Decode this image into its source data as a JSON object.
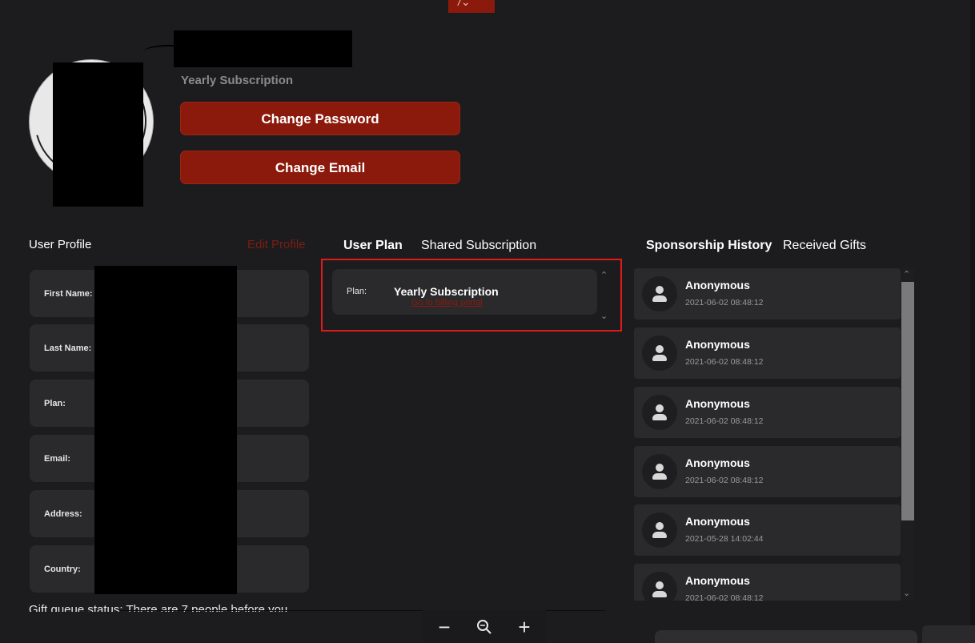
{
  "header": {
    "subscription_label": "Yearly Subscription",
    "change_password": "Change Password",
    "change_email": "Change Email"
  },
  "profile": {
    "title": "User Profile",
    "edit_label": "Edit Profile",
    "fields": [
      {
        "label": "First Name:"
      },
      {
        "label": "Last Name:"
      },
      {
        "label": "Plan:"
      },
      {
        "label": "Email:"
      },
      {
        "label": "Address:"
      },
      {
        "label": "Country:"
      }
    ],
    "gift_status": "Gift queue status: There are 7 people before you"
  },
  "plan": {
    "tabs": [
      "User Plan",
      "Shared Subscription"
    ],
    "active_tab": "User Plan",
    "label": "Plan:",
    "value": "Yearly Subscription",
    "billing_link": "Go to billing portal"
  },
  "sponsorship": {
    "tabs": [
      "Sponsorship History",
      "Received Gifts"
    ],
    "active_tab": "Sponsorship History",
    "items": [
      {
        "name": "Anonymous",
        "date": "2021-06-02 08:48:12"
      },
      {
        "name": "Anonymous",
        "date": "2021-06-02 08:48:12"
      },
      {
        "name": "Anonymous",
        "date": "2021-06-02 08:48:12"
      },
      {
        "name": "Anonymous",
        "date": "2021-06-02 08:48:12"
      },
      {
        "name": "Anonymous",
        "date": "2021-05-28 14:02:44"
      },
      {
        "name": "Anonymous",
        "date": "2021-06-02 08:48:12"
      }
    ]
  },
  "zoom": {
    "minus": "−",
    "plus": "+"
  },
  "colors": {
    "accent": "#8b1a0c",
    "highlight_border": "#e01a1a",
    "background": "#1c1c1e",
    "card": "#2a2a2c"
  }
}
